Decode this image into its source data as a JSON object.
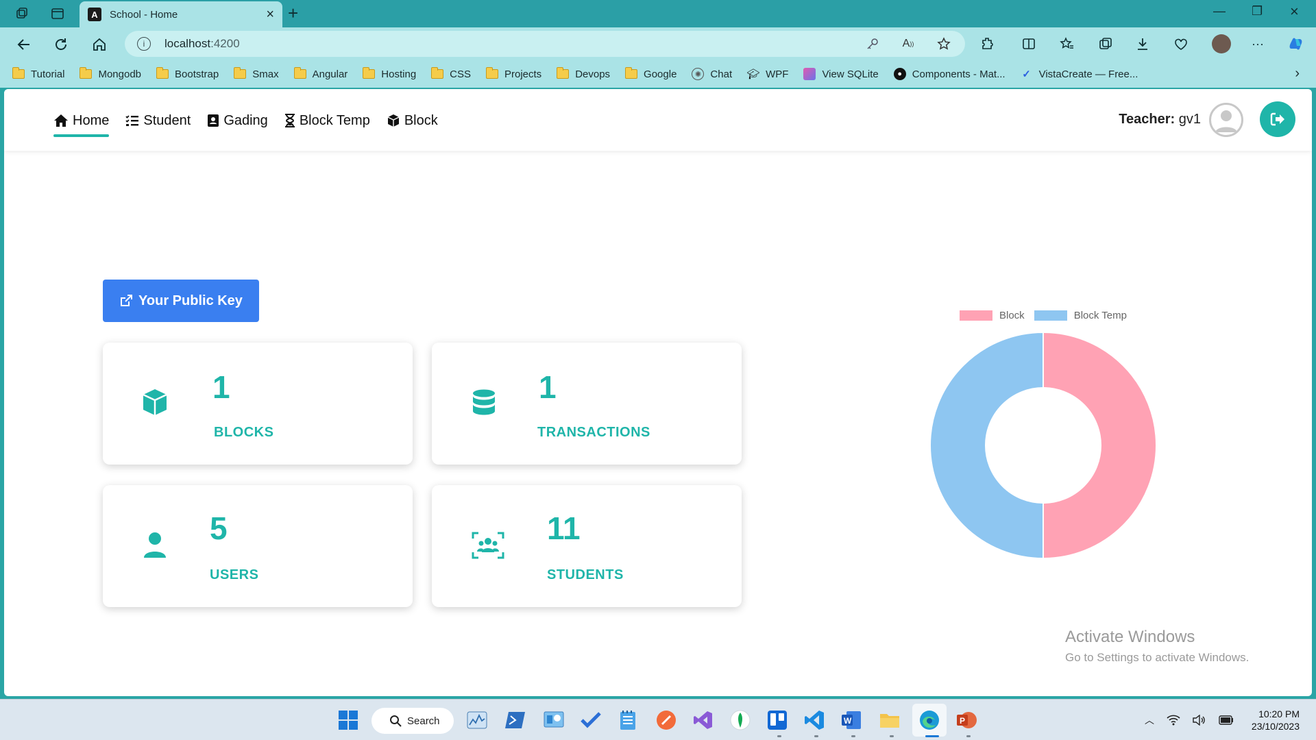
{
  "browser": {
    "tab_title": "School - Home",
    "url_host": "localhost",
    "url_port": ":4200"
  },
  "bookmarks": [
    {
      "label": "Tutorial",
      "icon": "folder-icon"
    },
    {
      "label": "Mongodb",
      "icon": "folder-icon"
    },
    {
      "label": "Bootstrap",
      "icon": "folder-icon"
    },
    {
      "label": "Smax",
      "icon": "folder-icon"
    },
    {
      "label": "Angular",
      "icon": "folder-icon"
    },
    {
      "label": "Hosting",
      "icon": "folder-icon"
    },
    {
      "label": "CSS",
      "icon": "folder-icon"
    },
    {
      "label": "Projects",
      "icon": "folder-icon"
    },
    {
      "label": "Devops",
      "icon": "folder-icon"
    },
    {
      "label": "Google",
      "icon": "folder-icon"
    },
    {
      "label": "Chat",
      "icon": "chatgpt-icon"
    },
    {
      "label": "WPF",
      "icon": "graduation-cap-icon"
    },
    {
      "label": "View SQLite",
      "icon": "sqlite-icon"
    },
    {
      "label": "Components - Mat...",
      "icon": "github-icon"
    },
    {
      "label": "VistaCreate — Free...",
      "icon": "vistacreate-icon"
    }
  ],
  "nav": {
    "items": [
      {
        "label": "Home",
        "icon": "home-icon",
        "active": true
      },
      {
        "label": "Student",
        "icon": "list-icon",
        "active": false
      },
      {
        "label": "Gading",
        "icon": "contact-book-icon",
        "active": false
      },
      {
        "label": "Block Temp",
        "icon": "hourglass-icon",
        "active": false
      },
      {
        "label": "Block",
        "icon": "cube-icon",
        "active": false
      }
    ],
    "teacher_label": "Teacher:",
    "teacher_name": " gv1"
  },
  "main": {
    "public_key_button": "Your Public Key",
    "cards": [
      {
        "value": "1",
        "label": "BLOCKS",
        "icon": "cube-icon"
      },
      {
        "value": "1",
        "label": "TRANSACTIONS",
        "icon": "database-icon"
      },
      {
        "value": "5",
        "label": "USERS",
        "icon": "user-icon"
      },
      {
        "value": "11",
        "label": "STUDENTS",
        "icon": "users-viewfinder-icon"
      }
    ],
    "accent_color": "#1fb5a9",
    "button_color": "#3a7ff0"
  },
  "chart_data": {
    "type": "pie",
    "variant": "doughnut",
    "categories": [
      "Block",
      "Block Temp"
    ],
    "values": [
      1,
      1
    ],
    "colors": [
      "#ffa2b4",
      "#8ec6f1"
    ],
    "legend": "top"
  },
  "watermark": {
    "title": "Activate Windows",
    "subtitle": "Go to Settings to activate Windows."
  },
  "taskbar": {
    "search_label": "Search",
    "time": "10:20 PM",
    "date": "23/10/2023"
  }
}
